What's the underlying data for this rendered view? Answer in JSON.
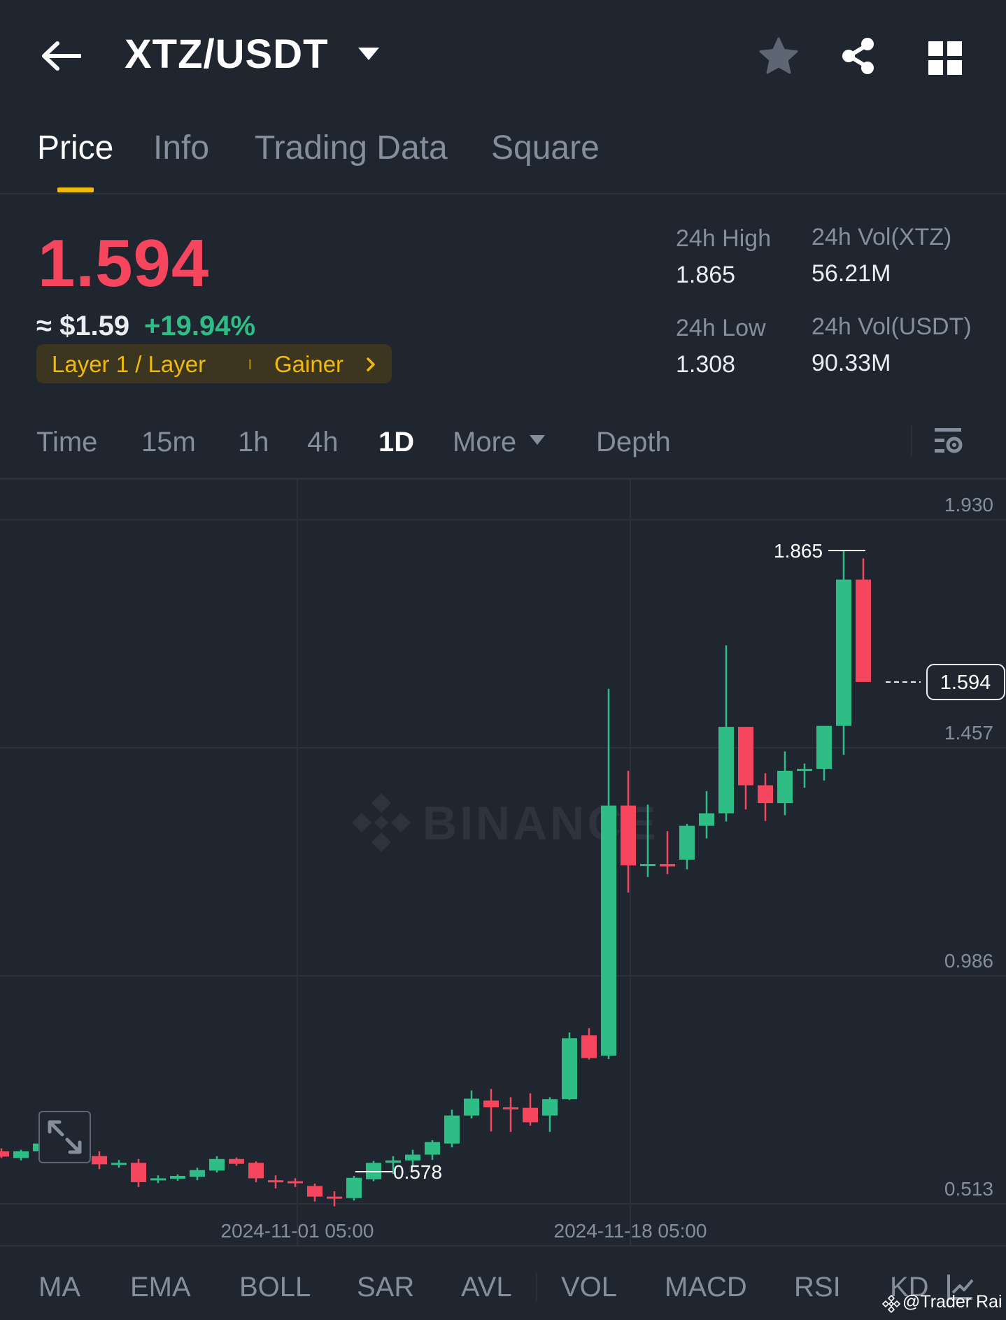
{
  "header": {
    "pair": "XTZ/USDT",
    "icons": [
      "back-arrow-icon",
      "caret-down-icon",
      "star-icon",
      "share-icon",
      "grid-icon"
    ]
  },
  "tabs": [
    {
      "label": "Price",
      "active": true
    },
    {
      "label": "Info",
      "active": false
    },
    {
      "label": "Trading Data",
      "active": false
    },
    {
      "label": "Square",
      "active": false
    }
  ],
  "ticker": {
    "last_price": "1.594",
    "approx_usd": "≈ $1.59",
    "change_pct": "+19.94%",
    "tag_category": "Layer 1 / Layer",
    "tag_badge": "Gainer",
    "high_label": "24h High",
    "high_value": "1.865",
    "low_label": "24h Low",
    "low_value": "1.308",
    "vol_base_label": "24h Vol(XTZ)",
    "vol_base_value": "56.21M",
    "vol_quote_label": "24h Vol(USDT)",
    "vol_quote_value": "90.33M",
    "colors": {
      "up": "#2ebd85",
      "down": "#f6465d",
      "accent": "#f0b90b"
    }
  },
  "timeframes": {
    "items": [
      "Time",
      "15m",
      "1h",
      "4h",
      "1D",
      "More",
      "Depth"
    ],
    "active": "1D"
  },
  "indicators": {
    "items": [
      "MA",
      "EMA",
      "BOLL",
      "SAR",
      "AVL",
      "VOL",
      "MACD",
      "RSI",
      "KD"
    ]
  },
  "credit": "@Trader Rai",
  "chart_data": {
    "type": "candlestick",
    "interval": "1D",
    "y_ticks": [
      "1.930",
      "1.457",
      "0.986",
      "0.513"
    ],
    "ylim": [
      0.513,
      1.93
    ],
    "x_ticks": [
      "2024-11-01 05:00",
      "2024-11-18 05:00"
    ],
    "high_annotation": "1.865",
    "low_annotation": "0.578",
    "current_price_label": "1.594",
    "watermark": "BINANCE",
    "grid": true,
    "candles": [
      {
        "o": 0.622,
        "h": 0.628,
        "l": 0.608,
        "c": 0.611
      },
      {
        "o": 0.608,
        "h": 0.625,
        "l": 0.603,
        "c": 0.622
      },
      {
        "o": 0.622,
        "h": 0.642,
        "l": 0.618,
        "c": 0.638
      },
      {
        "o": 0.638,
        "h": 0.642,
        "l": 0.628,
        "c": 0.632
      },
      {
        "o": 0.628,
        "h": 0.635,
        "l": 0.602,
        "c": 0.612
      },
      {
        "o": 0.612,
        "h": 0.622,
        "l": 0.585,
        "c": 0.595
      },
      {
        "o": 0.595,
        "h": 0.604,
        "l": 0.588,
        "c": 0.598
      },
      {
        "o": 0.598,
        "h": 0.606,
        "l": 0.548,
        "c": 0.558
      },
      {
        "o": 0.562,
        "h": 0.572,
        "l": 0.556,
        "c": 0.566
      },
      {
        "o": 0.565,
        "h": 0.574,
        "l": 0.561,
        "c": 0.571
      },
      {
        "o": 0.569,
        "h": 0.588,
        "l": 0.562,
        "c": 0.583
      },
      {
        "o": 0.582,
        "h": 0.612,
        "l": 0.578,
        "c": 0.606
      },
      {
        "o": 0.606,
        "h": 0.609,
        "l": 0.592,
        "c": 0.596
      },
      {
        "o": 0.598,
        "h": 0.601,
        "l": 0.558,
        "c": 0.566
      },
      {
        "o": 0.562,
        "h": 0.572,
        "l": 0.545,
        "c": 0.558
      },
      {
        "o": 0.56,
        "h": 0.566,
        "l": 0.548,
        "c": 0.557
      },
      {
        "o": 0.55,
        "h": 0.555,
        "l": 0.518,
        "c": 0.528
      },
      {
        "o": 0.528,
        "h": 0.539,
        "l": 0.508,
        "c": 0.526
      },
      {
        "o": 0.525,
        "h": 0.571,
        "l": 0.52,
        "c": 0.567
      },
      {
        "o": 0.564,
        "h": 0.602,
        "l": 0.56,
        "c": 0.598
      },
      {
        "o": 0.598,
        "h": 0.612,
        "l": 0.575,
        "c": 0.603
      },
      {
        "o": 0.603,
        "h": 0.625,
        "l": 0.59,
        "c": 0.615
      },
      {
        "o": 0.615,
        "h": 0.645,
        "l": 0.604,
        "c": 0.641
      },
      {
        "o": 0.638,
        "h": 0.708,
        "l": 0.63,
        "c": 0.696
      },
      {
        "o": 0.696,
        "h": 0.748,
        "l": 0.69,
        "c": 0.731
      },
      {
        "o": 0.727,
        "h": 0.751,
        "l": 0.663,
        "c": 0.713
      },
      {
        "o": 0.713,
        "h": 0.734,
        "l": 0.662,
        "c": 0.712
      },
      {
        "o": 0.712,
        "h": 0.742,
        "l": 0.675,
        "c": 0.682
      },
      {
        "o": 0.696,
        "h": 0.734,
        "l": 0.662,
        "c": 0.73
      },
      {
        "o": 0.73,
        "h": 0.868,
        "l": 0.728,
        "c": 0.856
      },
      {
        "o": 0.862,
        "h": 0.877,
        "l": 0.812,
        "c": 0.815
      },
      {
        "o": 0.82,
        "h": 1.58,
        "l": 0.813,
        "c": 1.338
      },
      {
        "o": 1.338,
        "h": 1.41,
        "l": 1.158,
        "c": 1.214
      },
      {
        "o": 1.214,
        "h": 1.34,
        "l": 1.19,
        "c": 1.217
      },
      {
        "o": 1.217,
        "h": 1.285,
        "l": 1.196,
        "c": 1.212
      },
      {
        "o": 1.226,
        "h": 1.3,
        "l": 1.206,
        "c": 1.296
      },
      {
        "o": 1.296,
        "h": 1.368,
        "l": 1.27,
        "c": 1.322
      },
      {
        "o": 1.322,
        "h": 1.67,
        "l": 1.305,
        "c": 1.501
      },
      {
        "o": 1.501,
        "h": 1.501,
        "l": 1.33,
        "c": 1.38
      },
      {
        "o": 1.38,
        "h": 1.405,
        "l": 1.306,
        "c": 1.343
      },
      {
        "o": 1.343,
        "h": 1.45,
        "l": 1.318,
        "c": 1.41
      },
      {
        "o": 1.41,
        "h": 1.425,
        "l": 1.375,
        "c": 1.414
      },
      {
        "o": 1.414,
        "h": 1.482,
        "l": 1.39,
        "c": 1.503
      },
      {
        "o": 1.503,
        "h": 1.865,
        "l": 1.443,
        "c": 1.806
      },
      {
        "o": 1.806,
        "h": 1.85,
        "l": 1.594,
        "c": 1.594
      }
    ]
  }
}
